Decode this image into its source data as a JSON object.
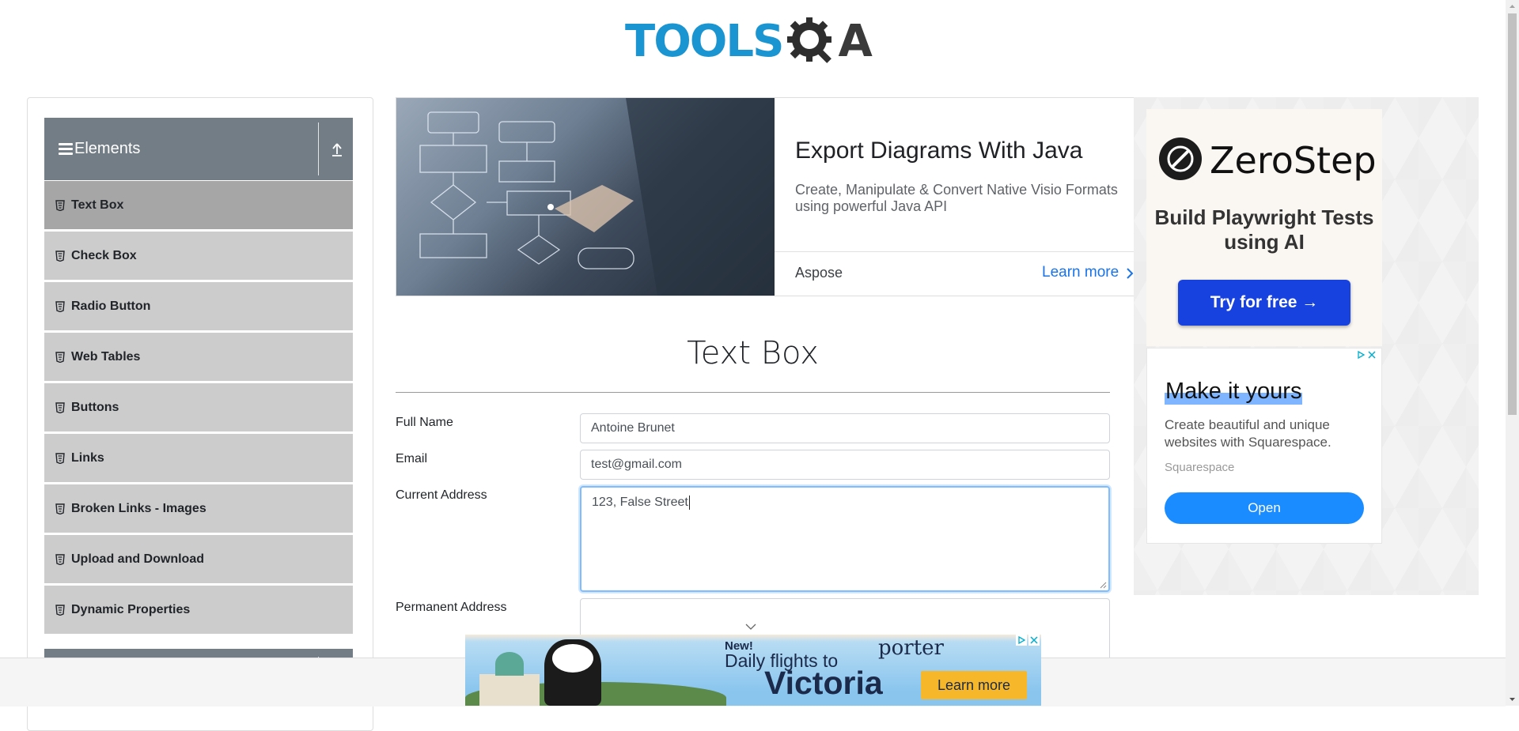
{
  "header": {
    "logo_part1": "TOOLS",
    "logo_part2": "A",
    "logo_alt": "ToolsQA"
  },
  "sidebar": {
    "group_title": "Elements",
    "items": [
      {
        "label": "Text Box",
        "active": true
      },
      {
        "label": "Check Box"
      },
      {
        "label": "Radio Button"
      },
      {
        "label": "Web Tables"
      },
      {
        "label": "Buttons"
      },
      {
        "label": "Links"
      },
      {
        "label": "Broken Links - Images"
      },
      {
        "label": "Upload and Download"
      },
      {
        "label": "Dynamic Properties"
      }
    ]
  },
  "top_ad": {
    "title": "Export Diagrams With Java",
    "description": "Create, Manipulate & Convert Native Visio Formats using powerful Java API",
    "brand": "Aspose",
    "cta": "Learn more"
  },
  "form": {
    "title": "Text Box",
    "full_name_label": "Full Name",
    "full_name_value": "Antoine Brunet",
    "email_label": "Email",
    "email_value": "test@gmail.com",
    "current_address_label": "Current Address",
    "current_address_value": "123, False Street",
    "permanent_address_label": "Permanent Address",
    "permanent_address_value": ""
  },
  "right_ad_1": {
    "brand": "ZeroStep",
    "tagline": "Build Playwright Tests using AI",
    "cta": "Try for free →"
  },
  "right_ad_2": {
    "title": "Make it yours",
    "description": "Create beautiful and unique websites with Squarespace.",
    "brand": "Squarespace",
    "cta": "Open"
  },
  "bottom_ad": {
    "new_label": "New!",
    "line1": "Daily flights to",
    "line2": "Victoria",
    "brand": "porter",
    "cta": "Learn more"
  },
  "colors": {
    "accent_blue": "#1a95d1",
    "sidebar_header": "#737d86",
    "menu_item": "#cccccc",
    "menu_active": "#a6a6a6",
    "link_blue": "#1a73e8",
    "zerostep_button": "#1742e0",
    "squarespace_button": "#1a8cff",
    "porter_button": "#f6b82a"
  }
}
